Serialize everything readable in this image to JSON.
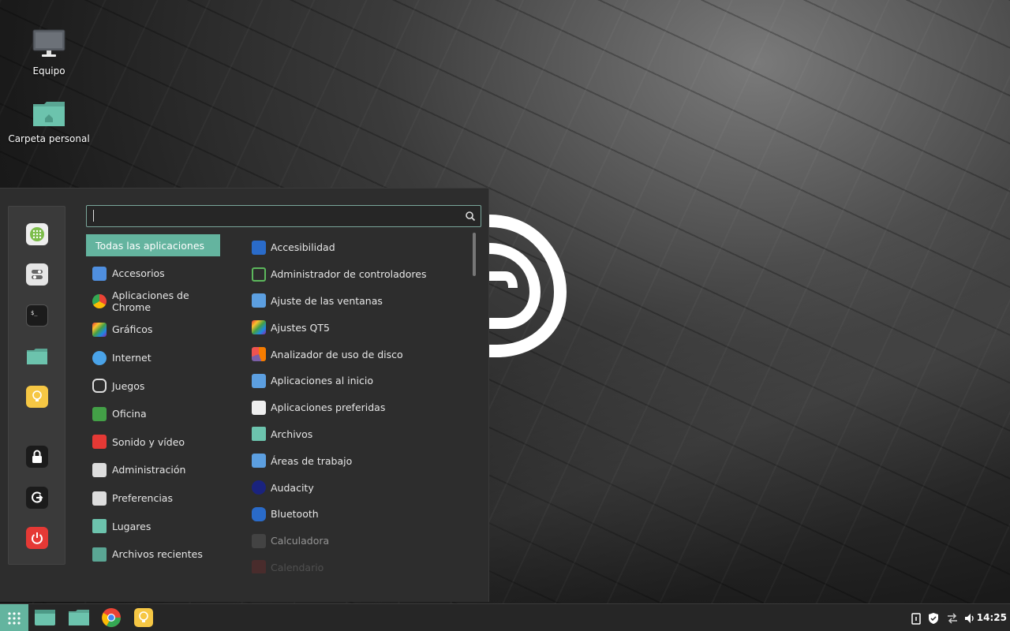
{
  "desktop": {
    "icons": [
      {
        "label": "Equipo",
        "icon": "computer-icon"
      },
      {
        "label": "Carpeta personal",
        "icon": "home-folder-icon"
      }
    ]
  },
  "menu": {
    "search": {
      "value": "",
      "placeholder": ""
    },
    "favorites": [
      {
        "name": "software-manager-icon"
      },
      {
        "name": "settings-icon"
      },
      {
        "name": "terminal-icon"
      },
      {
        "name": "files-icon"
      },
      {
        "name": "notes-icon"
      },
      {
        "name": "lock-icon"
      },
      {
        "name": "logout-icon"
      },
      {
        "name": "shutdown-icon"
      }
    ],
    "categories": [
      {
        "label": "Todas las aplicaciones",
        "active": true
      },
      {
        "label": "Accesorios"
      },
      {
        "label": "Aplicaciones de Chrome"
      },
      {
        "label": "Gráficos"
      },
      {
        "label": "Internet"
      },
      {
        "label": "Juegos"
      },
      {
        "label": "Oficina"
      },
      {
        "label": "Sonido y vídeo"
      },
      {
        "label": "Administración"
      },
      {
        "label": "Preferencias"
      },
      {
        "label": "Lugares"
      },
      {
        "label": "Archivos recientes"
      }
    ],
    "apps": [
      {
        "label": "Accesibilidad"
      },
      {
        "label": "Administrador de controladores"
      },
      {
        "label": "Ajuste de las ventanas"
      },
      {
        "label": "Ajustes QT5"
      },
      {
        "label": "Analizador de uso de disco"
      },
      {
        "label": "Aplicaciones al inicio"
      },
      {
        "label": "Aplicaciones preferidas"
      },
      {
        "label": "Archivos"
      },
      {
        "label": "Áreas de trabajo"
      },
      {
        "label": "Audacity"
      },
      {
        "label": "Bluetooth"
      },
      {
        "label": "Calculadora"
      },
      {
        "label": "Calendario"
      }
    ]
  },
  "taskbar": {
    "clock": "14:25",
    "pinned": [
      "terminal-app",
      "files-app",
      "chrome-app",
      "notes-app"
    ]
  },
  "colors": {
    "accent": "#64b49f",
    "panel": "#2d2d2d",
    "taskbar": "#262626"
  }
}
